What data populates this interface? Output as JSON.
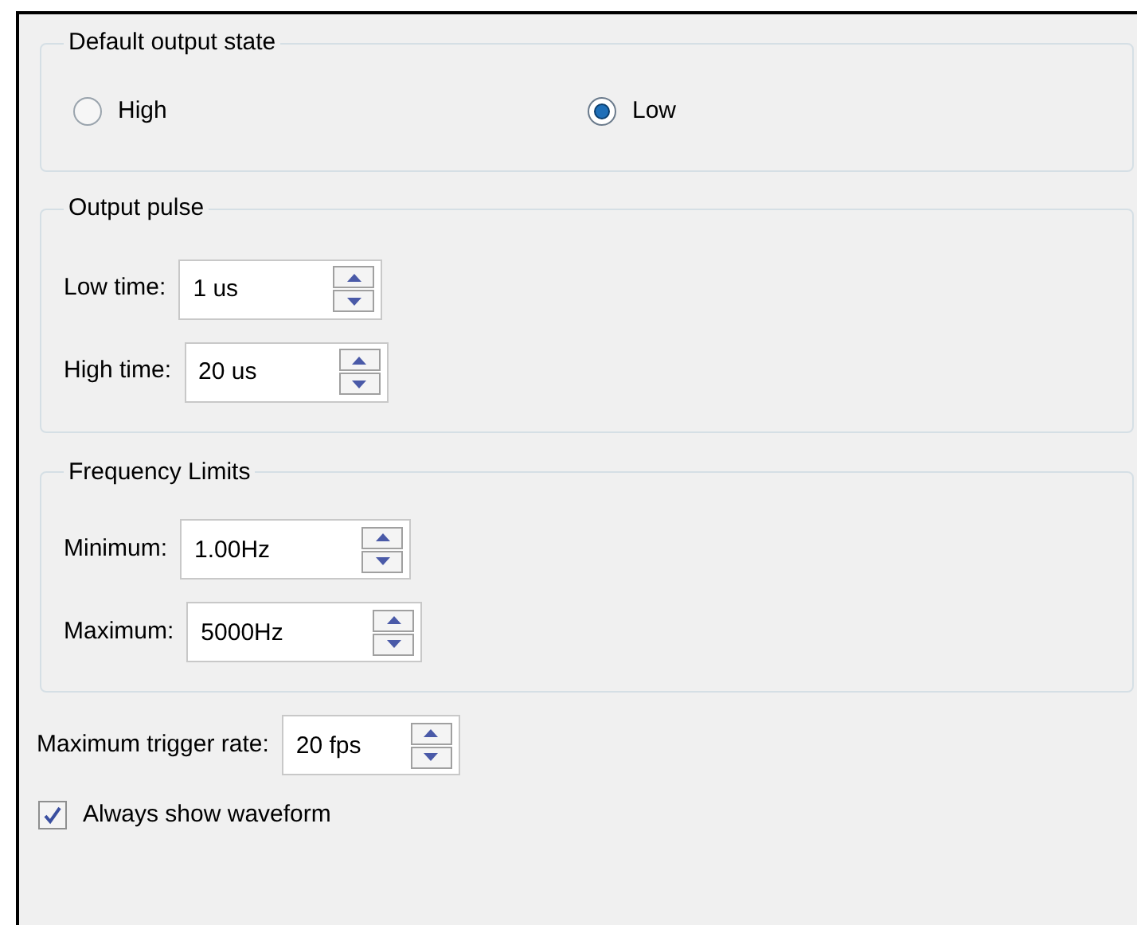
{
  "default_output_state": {
    "title": "Default output state",
    "options": [
      {
        "label": "High",
        "selected": false
      },
      {
        "label": "Low",
        "selected": true
      }
    ]
  },
  "output_pulse": {
    "title": "Output pulse",
    "fields": [
      {
        "label": "Low time:",
        "value": "1 us"
      },
      {
        "label": "High time:",
        "value": "20 us"
      }
    ]
  },
  "frequency_limits": {
    "title": "Frequency Limits",
    "fields": [
      {
        "label": "Minimum:",
        "value": "1.00Hz"
      },
      {
        "label": "Maximum:",
        "value": "5000Hz"
      }
    ]
  },
  "trigger_rate": {
    "label": "Maximum trigger rate:",
    "value": "20 fps"
  },
  "always_show_waveform": {
    "label": "Always show waveform",
    "checked": true
  }
}
